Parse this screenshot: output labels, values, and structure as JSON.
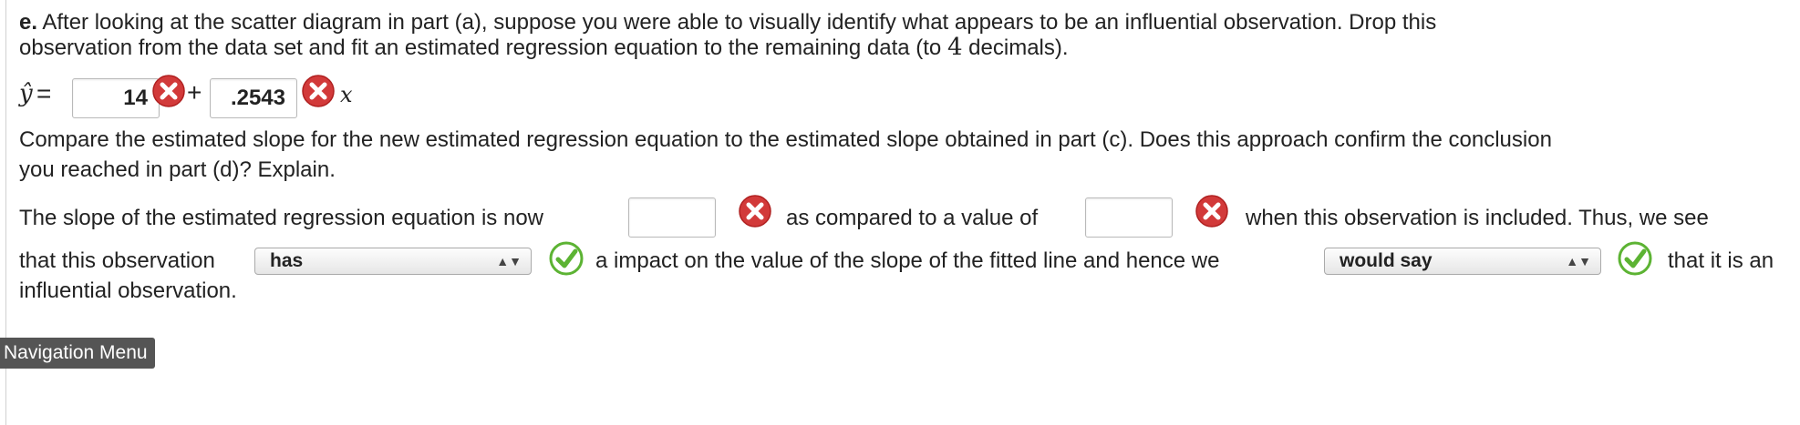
{
  "part_e": {
    "label": "e.",
    "line1": "After looking at the scatter diagram in part (a), suppose you were able to visually identify what appears to be an influential observation. Drop this",
    "line2_a": "observation from the data set and fit an estimated regression equation to the remaining data (to",
    "line2_num": "4",
    "line2_b": "decimals)."
  },
  "equation": {
    "yhat": "ŷ",
    "equals": "=",
    "intercept_value": "14",
    "plus": "+",
    "slope_value": ".2543",
    "x": "x"
  },
  "compare": {
    "line1": "Compare the estimated slope for the new estimated regression equation to the estimated slope obtained in part (c). Does this approach confirm the conclusion",
    "line2": "you reached in part (d)? Explain."
  },
  "sentence": {
    "part1": "The slope of the estimated regression equation is now",
    "new_slope_value": "",
    "part2": "as compared to a value of",
    "old_slope_value": "",
    "part3": "when this observation is included. Thus, we see",
    "part4": "that this observation",
    "impact_selected": "has",
    "part5": "a impact on the value of the slope of the fitted line and hence we",
    "conclusion_selected": "would say",
    "part6": "that it is an",
    "part7": "influential observation."
  },
  "tooltip": "Navigation Menu",
  "colors": {
    "wrong": "#d23a3a",
    "correct": "#5cb333"
  }
}
